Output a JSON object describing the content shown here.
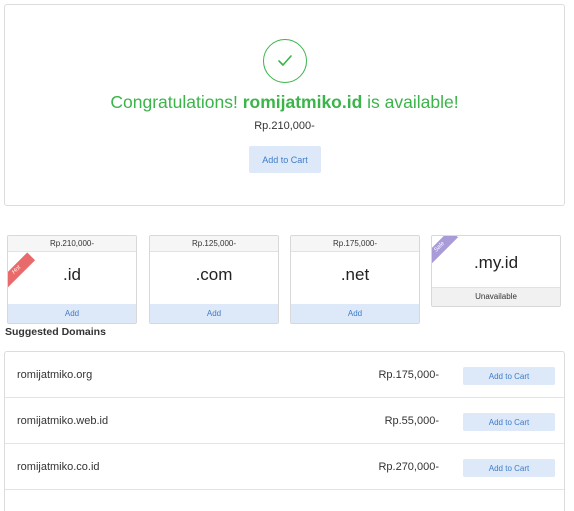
{
  "result": {
    "prefix": "Congratulations! ",
    "domain": "romijatmiko.id",
    "suffix": " is available!",
    "price": "Rp.210,000-",
    "add_label": "Add to Cart",
    "accent_color": "#3bb44a"
  },
  "tlds": [
    {
      "price": "Rp.210,000-",
      "name": ".id",
      "action": "Add",
      "ribbon": "Hot"
    },
    {
      "price": "Rp.125,000-",
      "name": ".com",
      "action": "Add"
    },
    {
      "price": "Rp.175,000-",
      "name": ".net",
      "action": "Add"
    },
    {
      "name": ".my.id",
      "status": "Unavailable",
      "ribbon": "Sale"
    }
  ],
  "suggestions": {
    "title": "Suggested Domains",
    "items": [
      {
        "domain": "romijatmiko.org",
        "price": "Rp.175,000-",
        "button": "Add to Cart"
      },
      {
        "domain": "romijatmiko.web.id",
        "price": "Rp.55,000-",
        "button": "Add to Cart"
      },
      {
        "domain": "romijatmiko.co.id",
        "price": "Rp.270,000-",
        "button": "Add to Cart"
      }
    ]
  },
  "icons": {
    "success": "check-icon",
    "hot": "hot-ribbon",
    "sale": "sale-ribbon"
  }
}
